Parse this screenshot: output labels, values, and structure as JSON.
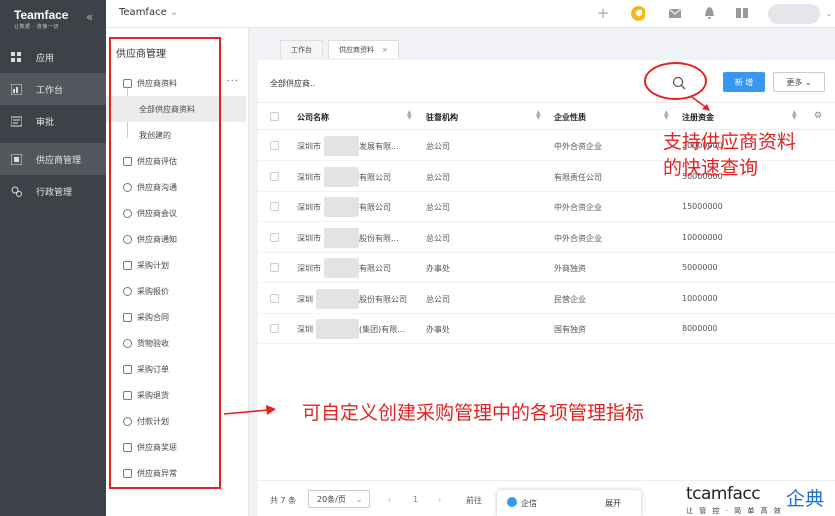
{
  "brand": {
    "title": "Teamface",
    "subtitle": "让数据 · 连接一切"
  },
  "nav": {
    "items": [
      {
        "label": "应用",
        "icon": "apps-icon"
      },
      {
        "label": "工作台",
        "icon": "dashboard-icon"
      },
      {
        "label": "审批",
        "icon": "approval-icon"
      },
      {
        "label": "供应商管理",
        "icon": "supplier-icon"
      },
      {
        "label": "行政管理",
        "icon": "admin-icon"
      }
    ]
  },
  "topbar": {
    "title": "Teamface"
  },
  "sub": {
    "title": "供应商管理",
    "items": [
      {
        "label": "供应商资料"
      },
      {
        "label": "全部供应商资料"
      },
      {
        "label": "我创建的"
      },
      {
        "label": "供应商评估"
      },
      {
        "label": "供应商沟通"
      },
      {
        "label": "供应商会议"
      },
      {
        "label": "供应商通知"
      },
      {
        "label": "采购计划"
      },
      {
        "label": "采购报价"
      },
      {
        "label": "采购合同"
      },
      {
        "label": "货物验收"
      },
      {
        "label": "采购订单"
      },
      {
        "label": "采购退货"
      },
      {
        "label": "付款计划"
      },
      {
        "label": "供应商奖惩"
      },
      {
        "label": "供应商异常"
      }
    ]
  },
  "tabs": [
    {
      "label": "工作台"
    },
    {
      "label": "供应商资料"
    }
  ],
  "panel": {
    "title": "全部供应商..",
    "new_label": "新 增",
    "more_label": "更多",
    "columns": [
      "公司名称",
      "驻督机构",
      "企业性质",
      "注册资金"
    ],
    "rows": [
      {
        "a": "深圳市",
        "b": "发展有限...",
        "org": "总公司",
        "type": "中外合资企业",
        "cap": "20000000"
      },
      {
        "a": "深圳市",
        "b": "有限公司",
        "org": "总公司",
        "type": "有限责任公司",
        "cap": "50000000"
      },
      {
        "a": "深圳市",
        "b": "有限公司",
        "org": "总公司",
        "type": "中外合资企业",
        "cap": "15000000"
      },
      {
        "a": "深圳市",
        "b": "股份有限...",
        "org": "总公司",
        "type": "中外合资企业",
        "cap": "10000000"
      },
      {
        "a": "深圳市",
        "b": "有限公司",
        "org": "办事处",
        "type": "外商独资",
        "cap": "5000000"
      },
      {
        "a": "深圳",
        "b": "股份有限公司",
        "org": "总公司",
        "type": "民营企业",
        "cap": "1000000"
      },
      {
        "a": "深圳",
        "b": "(集团)有限...",
        "org": "办事处",
        "type": "国有独资",
        "cap": "8000000"
      }
    ],
    "total": "共 7 条",
    "page_size": "20条/页",
    "current_page": "1",
    "goto_label": "前往"
  },
  "chat": {
    "label": "企信",
    "expand": "展开"
  },
  "annotations": {
    "search_note_line1": "支持供应商资料",
    "search_note_line2": "的快速查询",
    "custom_note": "可自定义创建采购管理中的各项管理指标"
  },
  "logo": {
    "main": "tcamfacc",
    "cn": "企典",
    "sub": "让 管 控 · 简 单 高 效"
  }
}
